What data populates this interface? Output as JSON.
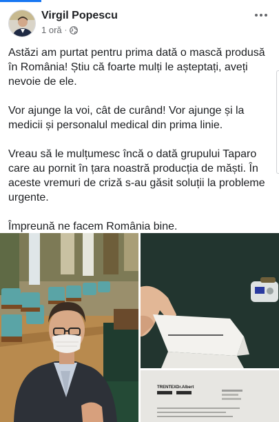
{
  "post": {
    "author_name": "Virgil Popescu",
    "timestamp": "1 oră",
    "separator": "·",
    "privacy_icon": "globe-icon",
    "more_icon": "more-horizontal-icon",
    "paragraphs": [
      "Astăzi am purtat pentru prima dată o mască produsă în România! Știu că foarte mulți le așteptați, aveți nevoie de ele.",
      "Vor ajunge la voi, cât de curând! Vor ajunge și la medicii și personalul medical din prima linie.",
      "Vreau să le mulțumesc încă o dată grupului Taparo care au pornit în țara noastră producția de măști. În aceste vremuri de criză s-au găsit soluții la probleme urgente.",
      "Împreună ne facem România bine."
    ]
  },
  "photos": {
    "letter_brand_left": "TRENTEX",
    "letter_brand_right": "Dr.Albert"
  },
  "colors": {
    "accent": "#1877f2",
    "text": "#1c1e21",
    "secondary_text": "#65676b"
  }
}
